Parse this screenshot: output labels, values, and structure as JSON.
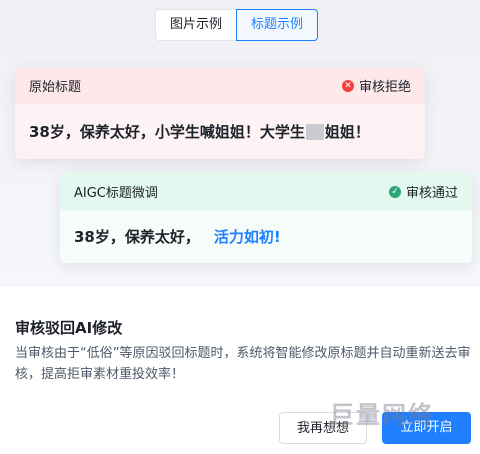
{
  "tabs": [
    {
      "label": "图片示例",
      "active": false
    },
    {
      "label": "标题示例",
      "active": true
    }
  ],
  "original_card": {
    "header_label": "原始标题",
    "status_label": "审核拒绝",
    "status_icon": "close-icon",
    "title_before": "38岁，保养太好，小学生喊姐姐！大学生",
    "title_after": "姐姐！",
    "accent_color": "#f53f3f"
  },
  "aigc_card": {
    "header_label": "AIGC标题微调",
    "status_label": "审核通过",
    "status_icon": "check-icon",
    "title_plain": "38岁，保养太好，",
    "title_highlight": "活力如初!",
    "accent_color": "#2fa57a",
    "highlight_color": "#1e80ff"
  },
  "feature": {
    "title": "审核驳回AI修改",
    "description": "当审核由于“低俗”等原因驳回标题时，系统将智能修改原标题并自动重新送去审核，提高拒审素材重投效率！"
  },
  "buttons": {
    "secondary": "我再想想",
    "primary": "立即开启"
  },
  "watermark": "巨量网络"
}
